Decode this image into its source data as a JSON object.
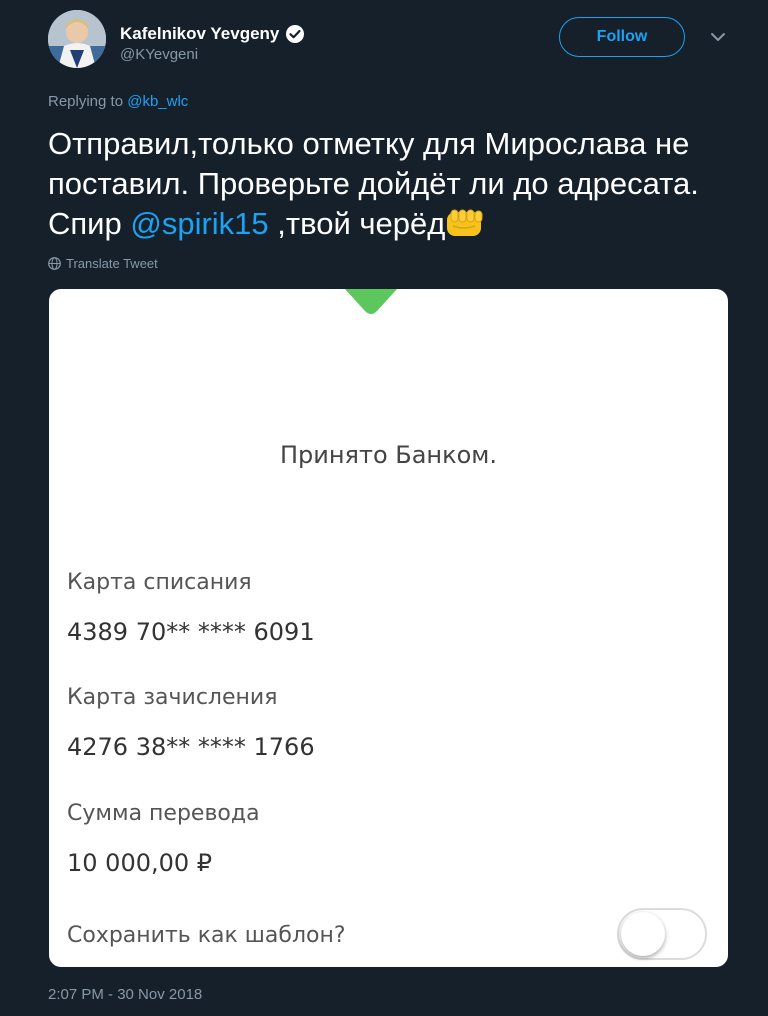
{
  "author": {
    "name": "Kafelnikov Yevgeny",
    "handle": "@KYevgeni",
    "verified_icon": "verified-badge-icon"
  },
  "header": {
    "follow_label": "Follow"
  },
  "reply": {
    "prefix": "Replying to",
    "to": "@kb_wlc"
  },
  "tweet": {
    "text_part1": "Отправил,только отметку для Мирослава не поставил. Проверьте дойдёт ли до адресата. Спир",
    "mention": "@spirik15",
    "text_part2": " ,твой черёд",
    "emoji_icon": "oncoming-fist-emoji"
  },
  "translate_label": "Translate Tweet",
  "card": {
    "status": "Принято Банком.",
    "fields": [
      {
        "label": "Карта списания",
        "value": "4389 70** **** 6091"
      },
      {
        "label": "Карта зачисления",
        "value": "4276 38** **** 1766"
      },
      {
        "label": "Сумма перевода",
        "value": "10 000,00 ₽"
      }
    ],
    "save_template_label": "Сохранить как шаблон?",
    "save_template_on": false
  },
  "timestamp": "2:07 PM - 30 Nov 2018",
  "colors": {
    "background": "#15202b",
    "accent": "#1da1f2",
    "muted": "#8899a6",
    "success_green": "#5cc75c"
  }
}
